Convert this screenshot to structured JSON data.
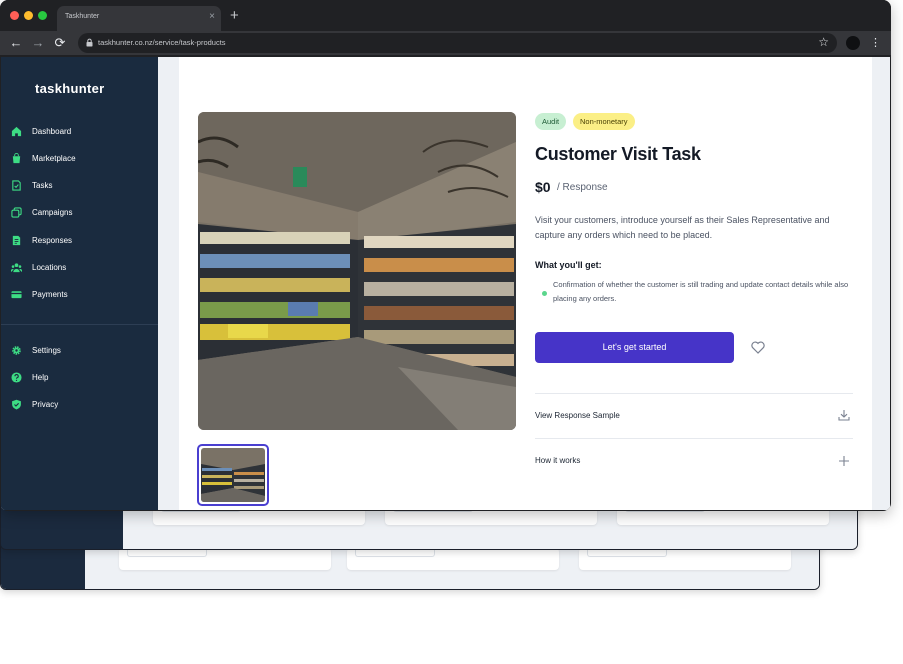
{
  "browser": {
    "tab_title": "Taskhunter",
    "tab_close": "×",
    "new_tab": "+",
    "url": "taskhunter.co.nz/service/task-products",
    "back": "←",
    "forward": "→",
    "reload": "⟳",
    "bookmark": "☆",
    "menu": "⋮"
  },
  "sidebar": {
    "logo": "taskhunter",
    "items": [
      {
        "label": "Dashboard",
        "icon": "home-icon"
      },
      {
        "label": "Marketplace",
        "icon": "bag-icon"
      },
      {
        "label": "Tasks",
        "icon": "task-doc-icon"
      },
      {
        "label": "Campaigns",
        "icon": "campaign-icon"
      },
      {
        "label": "Responses",
        "icon": "response-doc-icon"
      },
      {
        "label": "Locations",
        "icon": "people-icon"
      },
      {
        "label": "Payments",
        "icon": "card-icon"
      }
    ],
    "bottom_items": [
      {
        "label": "Settings",
        "icon": "gear-icon"
      },
      {
        "label": "Help",
        "icon": "help-icon"
      },
      {
        "label": "Privacy",
        "icon": "shield-icon"
      }
    ]
  },
  "task": {
    "badges": [
      "Audit",
      "Non-monetary"
    ],
    "title": "Customer Visit Task",
    "price": "$0",
    "price_unit": "/ Response",
    "description": "Visit your customers, introduce yourself as their Sales Representative and capture any orders which need to be placed.",
    "what_you_get_title": "What you'll get:",
    "benefits": [
      "Confirmation of whether the customer is still trading and update contact details while also placing any orders."
    ],
    "cta_label": "Let's get started",
    "rows": [
      {
        "label": "View Response Sample",
        "icon": "download-icon"
      },
      {
        "label": "How it works",
        "icon": "plus-icon"
      }
    ]
  },
  "colors": {
    "sidebar_bg": "#1a2b3f",
    "accent": "#4634c8",
    "nav_icon": "#3ddc84",
    "badge_audit": "#c7efd2",
    "badge_nonmonetary": "#fbef86"
  }
}
